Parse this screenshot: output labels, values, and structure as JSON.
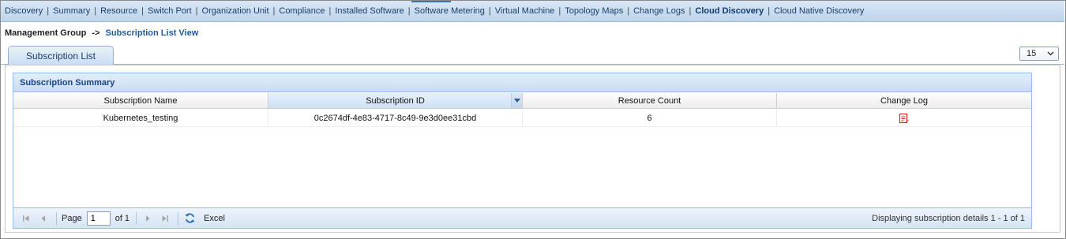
{
  "nav": {
    "items": [
      {
        "label": "Discovery",
        "active": false
      },
      {
        "label": "Summary",
        "active": false
      },
      {
        "label": "Resource",
        "active": false
      },
      {
        "label": "Switch Port",
        "active": false
      },
      {
        "label": "Organization Unit",
        "active": false
      },
      {
        "label": "Compliance",
        "active": false
      },
      {
        "label": "Installed Software",
        "active": false
      },
      {
        "label": "Software Metering",
        "active": false
      },
      {
        "label": "Virtual Machine",
        "active": false
      },
      {
        "label": "Topology Maps",
        "active": false
      },
      {
        "label": "Change Logs",
        "active": false
      },
      {
        "label": "Cloud Discovery",
        "active": true
      },
      {
        "label": "Cloud Native Discovery",
        "active": false
      }
    ],
    "separator": "|"
  },
  "breadcrumb": {
    "root": "Management Group",
    "arrow": "->",
    "current": "Subscription List View"
  },
  "tabs": {
    "active_label": "Subscription List"
  },
  "page_size": {
    "selected": "15",
    "icon": "chevron-down-icon"
  },
  "panel": {
    "title": "Subscription Summary"
  },
  "grid": {
    "columns": [
      "Subscription Name",
      "Subscription ID",
      "Resource Count",
      "Change Log"
    ],
    "sorted_column": "Subscription ID",
    "rows": [
      {
        "name": "Kubernetes_testing",
        "id": "0c2674df-4e83-4717-8c49-9e3d0ee31cbd",
        "resource_count": "6",
        "change_log_icon": "change-log-icon"
      }
    ]
  },
  "paging": {
    "page_label": "Page",
    "page_value": "1",
    "of_label": "of 1",
    "excel_label": "Excel",
    "display_text": "Displaying subscription details 1 - 1 of 1"
  },
  "colors": {
    "nav_bg": "#c9dcf0",
    "accent": "#15428b",
    "breadcrumb_current": "#1f5a9a",
    "changelog_icon": "#d0342c"
  }
}
